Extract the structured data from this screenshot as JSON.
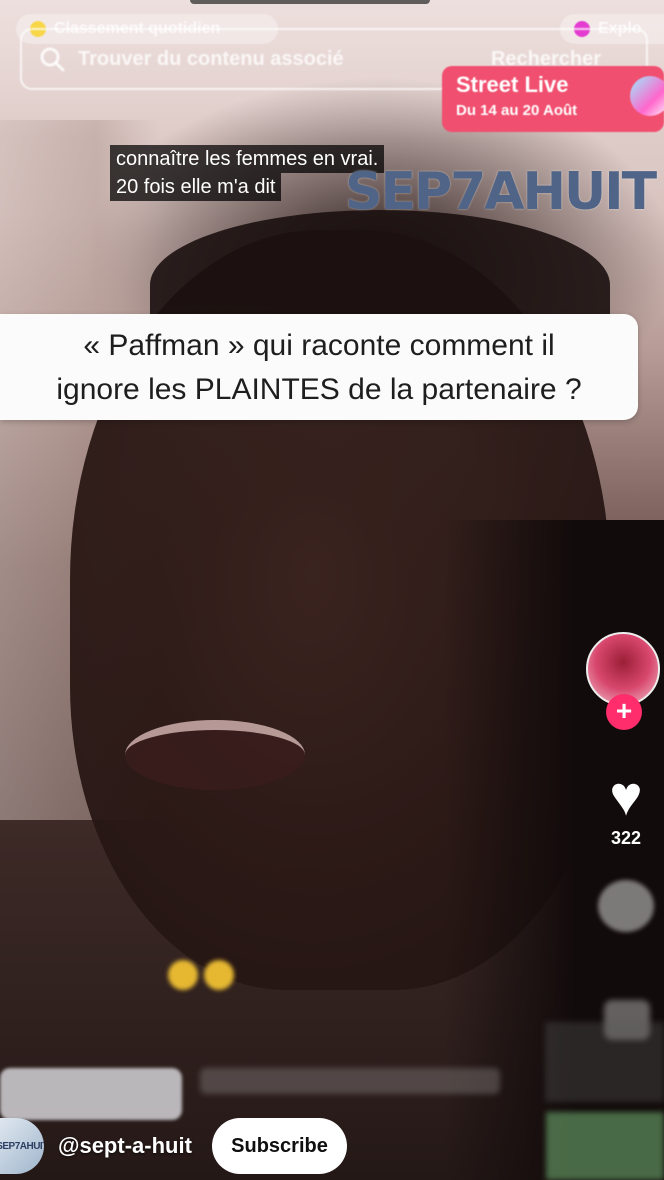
{
  "overlay": {
    "daily_ranking": "Classement quotidien",
    "explore": "Explo",
    "search_placeholder": "Trouver du contenu associé",
    "search_button": "Rechercher",
    "promo_title": "Street Live",
    "promo_dates": "Du 14 au 20 Août"
  },
  "captions": {
    "line1": "connaître les femmes en vrai.",
    "line2": "20 fois elle m'a dit"
  },
  "brand_watermark": "SEP7AHUIT",
  "banner": {
    "line1": "« Paffman » qui raconte comment il",
    "line2": "ignore les PLAINTES de la partenaire ?"
  },
  "actions": {
    "like_count": "322",
    "follow_symbol": "+",
    "heart_symbol": "♥"
  },
  "channel": {
    "handle": "@sept-a-huit",
    "subscribe_label": "Subscribe",
    "avatar_text": "SEP7AHUIT"
  },
  "colors": {
    "follow_pink": "#ff2d6c",
    "promo_red": "#f14f6f",
    "brand_blue": "#4f6487"
  }
}
